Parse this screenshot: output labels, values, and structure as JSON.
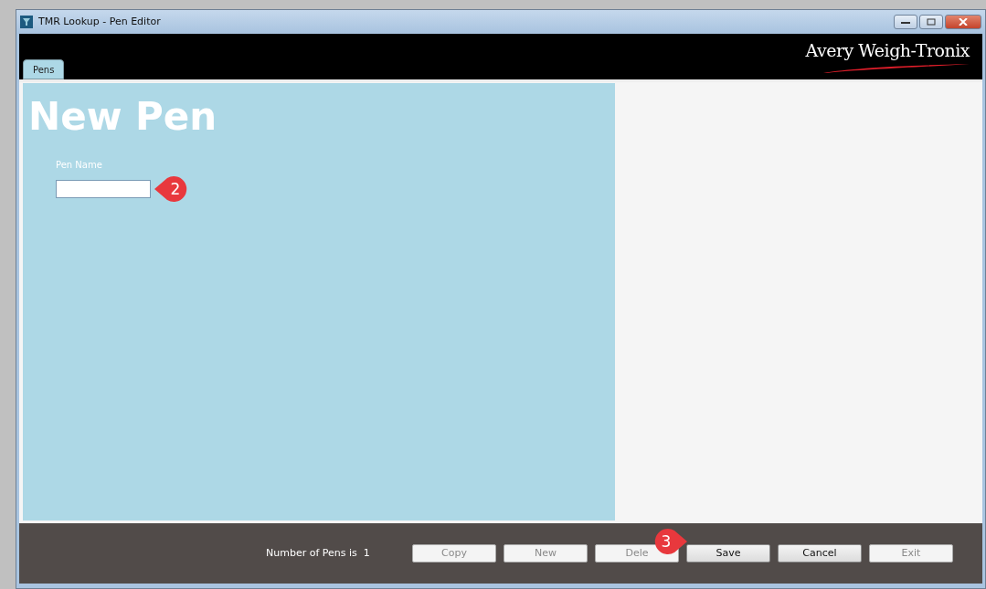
{
  "window": {
    "title": "TMR Lookup - Pen Editor"
  },
  "logo": {
    "text": "Avery Weigh-Tronix"
  },
  "tabs": [
    {
      "label": "Pens",
      "selected": true
    }
  ],
  "form": {
    "heading": "New Pen",
    "fields": [
      {
        "label": "Pen Name"
      }
    ]
  },
  "status": {
    "text": "Number of Pens is",
    "count": "1"
  },
  "buttons": [
    {
      "label": "Copy",
      "disabled": true
    },
    {
      "label": "New",
      "disabled": true
    },
    {
      "label": "Dele",
      "disabled": true
    },
    {
      "label": "Save",
      "disabled": false
    },
    {
      "label": "Cancel",
      "disabled": false
    },
    {
      "label": "Exit",
      "disabled": true
    }
  ],
  "callouts": [
    {
      "number": "2"
    },
    {
      "number": "3"
    }
  ]
}
